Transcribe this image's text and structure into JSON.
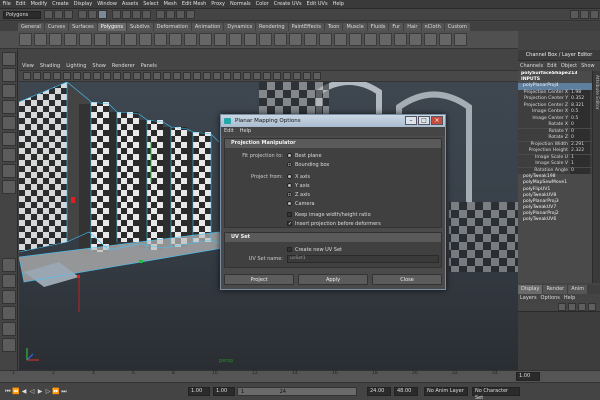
{
  "menubar": [
    "File",
    "Edit",
    "Modify",
    "Create",
    "Display",
    "Window",
    "Assets",
    "Select",
    "Mesh",
    "Edit Mesh",
    "Proxy",
    "Normals",
    "Color",
    "Create UVs",
    "Edit UVs",
    "Help"
  ],
  "mode": "Polygons",
  "shelf_tabs": [
    "General",
    "Curves",
    "Surfaces",
    "Polygons",
    "Subdivs",
    "Deformation",
    "Animation",
    "Dynamics",
    "Rendering",
    "PaintEffects",
    "Toon",
    "Muscle",
    "Fluids",
    "Fur",
    "Hair",
    "nCloth",
    "Custom"
  ],
  "shelf_active": "Polygons",
  "viewport_menu": [
    "View",
    "Shading",
    "Lighting",
    "Show",
    "Renderer",
    "Panels"
  ],
  "channel_box": {
    "title": "Channel Box / Layer Editor",
    "menu": [
      "Channels",
      "Edit",
      "Object",
      "Show"
    ],
    "shape": "polySurfaceShape213",
    "inputs_label": "INPUTS",
    "selected_node": "polyPlanarProj4",
    "attributes": [
      {
        "label": "Projection Center X",
        "value": "1.98"
      },
      {
        "label": "Projection Center Y",
        "value": "0.352"
      },
      {
        "label": "Projection Center Z",
        "value": "8.321"
      },
      {
        "label": "Image Center X",
        "value": "0.5"
      },
      {
        "label": "Image Center Y",
        "value": "0.5"
      },
      {
        "label": "Rotate X",
        "value": "0"
      },
      {
        "label": "Rotate Y",
        "value": "0"
      },
      {
        "label": "Rotate Z",
        "value": "0"
      },
      {
        "label": "Projection Width",
        "value": "2.291"
      },
      {
        "label": "Projection Height",
        "value": "2.322"
      },
      {
        "label": "Image Scale U",
        "value": "1"
      },
      {
        "label": "Image Scale V",
        "value": "1"
      },
      {
        "label": "Rotation Angle",
        "value": "0"
      }
    ],
    "nodes": [
      "polyTweak198",
      "polyMapSewMove1",
      "polyFlipUV1",
      "polyTweakUV8",
      "polyPlanarProj3",
      "polyTweakUV7",
      "polyPlanarProj2",
      "polyTweakUV6"
    ],
    "side_tab": "Attribute Editor"
  },
  "layer_editor": {
    "tabs": [
      "Display",
      "Render",
      "Anim"
    ],
    "active_tab": "Display",
    "menu": [
      "Layers",
      "Options",
      "Help"
    ]
  },
  "dialog": {
    "title": "Planar Mapping Options",
    "menu": [
      "Edit",
      "Help"
    ],
    "section1": "Projection Manipulator",
    "fit_label": "Fit projection to:",
    "fit_options": [
      {
        "label": "Best plane",
        "on": false
      },
      {
        "label": "Bounding box",
        "on": true
      }
    ],
    "from_label": "Project from:",
    "from_options": [
      {
        "label": "X axis",
        "on": false
      },
      {
        "label": "Y axis",
        "on": false
      },
      {
        "label": "Z axis",
        "on": true
      },
      {
        "label": "Camera",
        "on": false
      }
    ],
    "keep_ratio": "Keep image width/height ratio",
    "insert_before": "Insert projection before deformers",
    "section2": "UV Set",
    "create_uvset": "Create new UV Set",
    "uvset_label": "UV Set name:",
    "uvset_value": "uvSet1",
    "buttons": [
      "Project",
      "Apply",
      "Close"
    ]
  },
  "timeline": {
    "ticks": [
      "1",
      "2",
      "4",
      "6",
      "8",
      "10",
      "12",
      "14",
      "16",
      "18",
      "20",
      "22",
      "24"
    ],
    "current": "1.00",
    "range_start": "1.00",
    "range_inner_start": "1.00",
    "range_inner_marker": "1",
    "range_inner_end": "24",
    "range_end": "24.00",
    "range_max": "48.00",
    "anim_layer": "No Anim Layer",
    "char_set": "No Character Set"
  },
  "scene_label": "persp"
}
